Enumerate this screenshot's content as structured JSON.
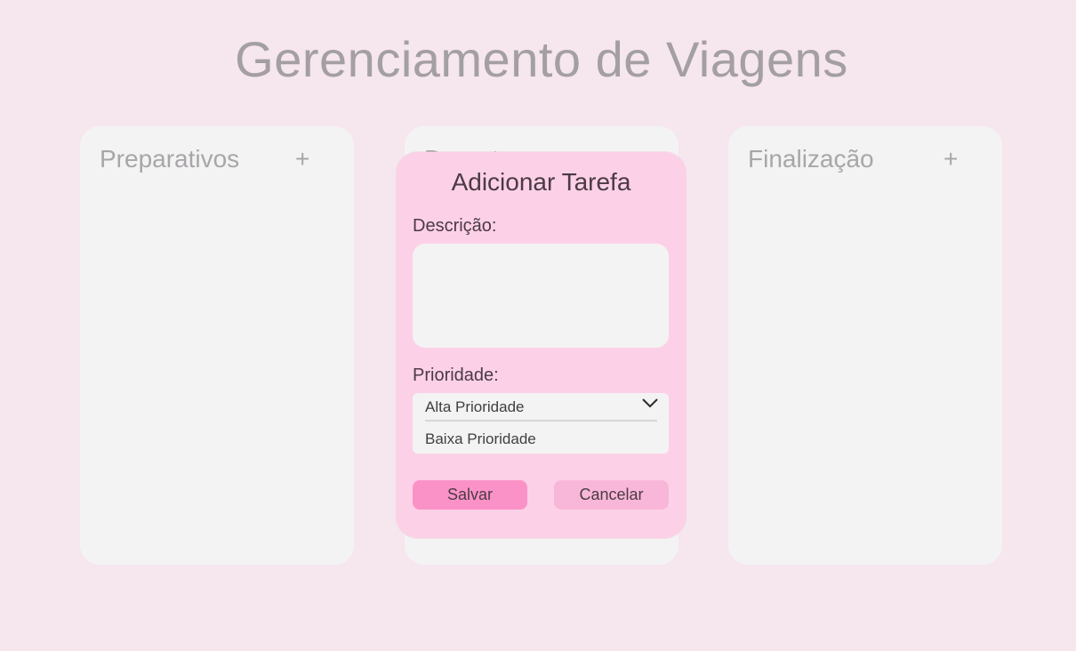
{
  "page": {
    "title": "Gerenciamento de Viagens"
  },
  "columns": [
    {
      "title": "Preparativos",
      "add_label": "+"
    },
    {
      "title": "Durante",
      "add_label": "+"
    },
    {
      "title": "Finalização",
      "add_label": "+"
    }
  ],
  "modal": {
    "title": "Adicionar Tarefa",
    "description_label": "Descrição:",
    "description_value": "",
    "priority_label": "Prioridade:",
    "priority_selected": "Alta Prioridade",
    "priority_options": [
      "Alta Prioridade",
      "Baixa Prioridade"
    ],
    "save_label": "Salvar",
    "cancel_label": "Cancelar"
  },
  "colors": {
    "background": "#f6e6ee",
    "modal": "#fcd1e8",
    "save_button": "#fb92c7",
    "cancel_button": "#f8b7d8",
    "column": "#f4f3f4"
  },
  "icons": {
    "dropdown": "chevron-down-icon"
  }
}
